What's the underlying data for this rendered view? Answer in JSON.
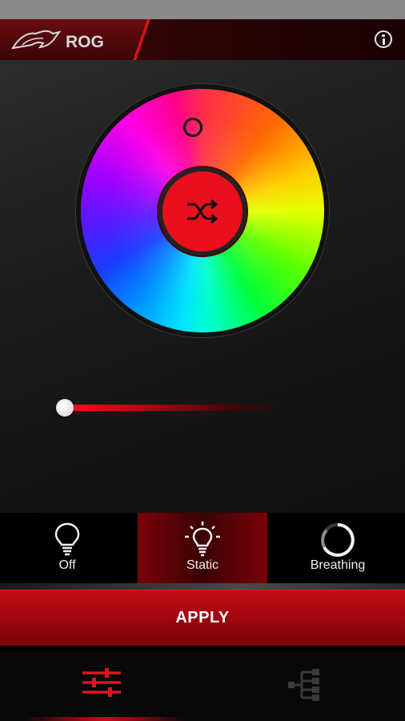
{
  "header": {
    "brand": "ROG",
    "info_icon": "info-icon"
  },
  "color_picker": {
    "random_icon": "shuffle-icon"
  },
  "brightness": {
    "value_fraction": 0.0
  },
  "modes": [
    {
      "label": "Off",
      "icon": "bulb-off-icon",
      "selected": false
    },
    {
      "label": "Static",
      "icon": "bulb-on-icon",
      "selected": true
    },
    {
      "label": "Breathing",
      "icon": "breathing-ring-icon",
      "selected": false
    }
  ],
  "apply": {
    "label": "APPLY"
  },
  "tabs": [
    {
      "name": "lighting",
      "icon": "sliders-icon",
      "active": true
    },
    {
      "name": "network",
      "icon": "tree-icon",
      "active": false
    }
  ],
  "colors": {
    "accent": "#ea0f1d",
    "active_tab": "#e01421",
    "inactive_tab": "#3a3a3a"
  }
}
